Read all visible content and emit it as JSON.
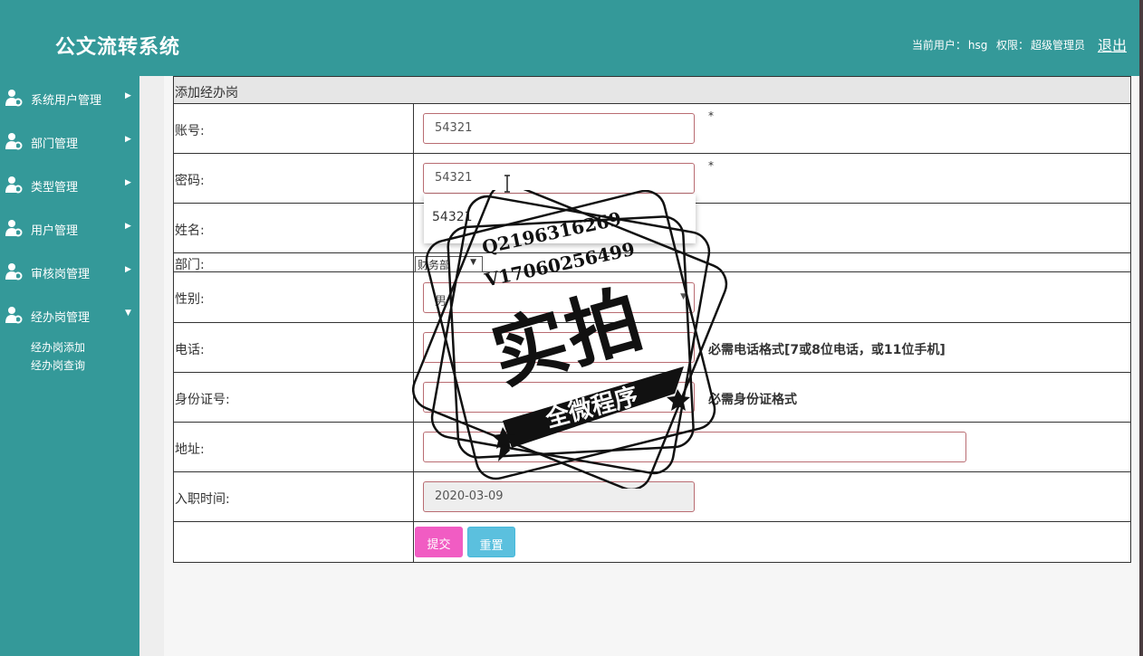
{
  "header": {
    "app_title": "公文流转系统",
    "current_user_label": "当前用户：",
    "current_user": "hsg",
    "permission_label": "权限：",
    "permission": "超级管理员",
    "logout": "退出"
  },
  "sidebar": {
    "items": [
      {
        "label": "系统用户管理",
        "expanded": false
      },
      {
        "label": "部门管理",
        "expanded": false
      },
      {
        "label": "类型管理",
        "expanded": false
      },
      {
        "label": "用户管理",
        "expanded": false
      },
      {
        "label": "审核岗管理",
        "expanded": false
      },
      {
        "label": "经办岗管理",
        "expanded": true
      }
    ],
    "subitems": [
      {
        "label": "经办岗添加"
      },
      {
        "label": "经办岗查询"
      }
    ]
  },
  "form": {
    "title": "添加经办岗",
    "account_label": "账号:",
    "account_value": "54321",
    "password_label": "密码:",
    "password_value": "54321",
    "name_label": "姓名:",
    "dept_label": "部门:",
    "dept_value": "财务部",
    "gender_label": "性别:",
    "gender_value": "男",
    "phone_label": "电话:",
    "phone_hint": "必需电话格式[7或8位电话，或11位手机]",
    "id_label": "身份证号:",
    "id_hint": "必需身份证格式",
    "address_label": "地址:",
    "hire_date_label": "入职时间:",
    "hire_date_value": "2020-03-09",
    "required_mark": "*",
    "autocomplete_value": "54321",
    "submit": "提交",
    "reset": "重置"
  },
  "watermark": {
    "line1": "Q2196316269",
    "line2": "V17060256499",
    "big": "实拍",
    "banner": "全微程序"
  },
  "colors": {
    "header_bg": "#349999",
    "submit_bg": "#f15cc3",
    "reset_bg": "#5bc0de",
    "input_border": "#b96c72"
  }
}
